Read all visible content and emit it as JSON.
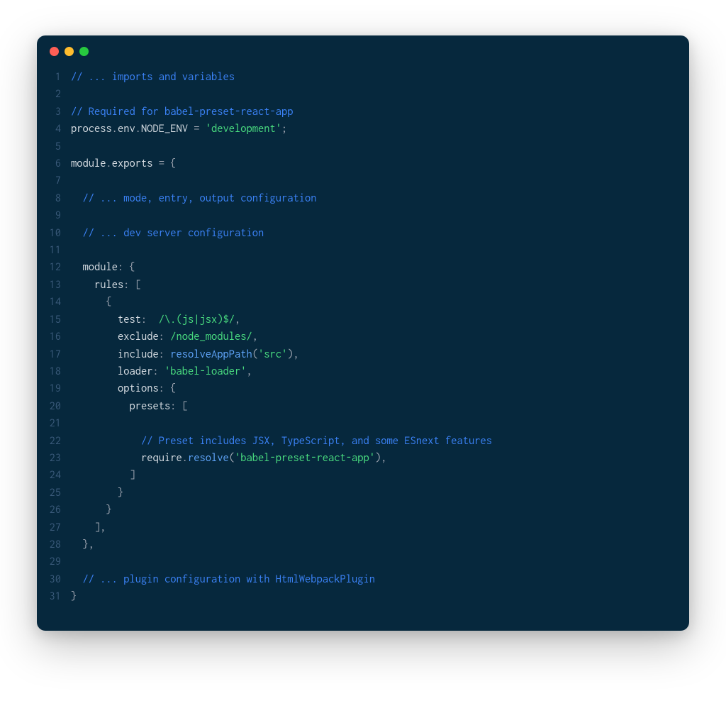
{
  "window": {
    "traffic_lights": {
      "close": "close",
      "minimize": "minimize",
      "maximize": "maximize"
    }
  },
  "code": {
    "lines": [
      {
        "num": "1",
        "tokens": [
          {
            "c": "tok-comment",
            "t": "// ... imports and variables"
          }
        ]
      },
      {
        "num": "2",
        "tokens": []
      },
      {
        "num": "3",
        "tokens": [
          {
            "c": "tok-comment",
            "t": "// Required for babel-preset-react-app"
          }
        ]
      },
      {
        "num": "4",
        "tokens": [
          {
            "c": "tok-ident",
            "t": "process"
          },
          {
            "c": "tok-punct",
            "t": "."
          },
          {
            "c": "tok-ident",
            "t": "env"
          },
          {
            "c": "tok-punct",
            "t": "."
          },
          {
            "c": "tok-ident",
            "t": "NODE_ENV"
          },
          {
            "c": "tok-op",
            "t": " = "
          },
          {
            "c": "tok-string",
            "t": "'development'"
          },
          {
            "c": "tok-punct",
            "t": ";"
          }
        ]
      },
      {
        "num": "5",
        "tokens": []
      },
      {
        "num": "6",
        "tokens": [
          {
            "c": "tok-ident",
            "t": "module"
          },
          {
            "c": "tok-punct",
            "t": "."
          },
          {
            "c": "tok-ident",
            "t": "exports"
          },
          {
            "c": "tok-op",
            "t": " = "
          },
          {
            "c": "tok-punct",
            "t": "{"
          }
        ]
      },
      {
        "num": "7",
        "tokens": []
      },
      {
        "num": "8",
        "tokens": [
          {
            "c": "",
            "t": "  "
          },
          {
            "c": "tok-comment",
            "t": "// ... mode, entry, output configuration"
          }
        ]
      },
      {
        "num": "9",
        "tokens": []
      },
      {
        "num": "10",
        "tokens": [
          {
            "c": "",
            "t": "  "
          },
          {
            "c": "tok-comment",
            "t": "// ... dev server configuration"
          }
        ]
      },
      {
        "num": "11",
        "tokens": []
      },
      {
        "num": "12",
        "tokens": [
          {
            "c": "",
            "t": "  "
          },
          {
            "c": "tok-prop",
            "t": "module"
          },
          {
            "c": "tok-punct",
            "t": ": {"
          }
        ]
      },
      {
        "num": "13",
        "tokens": [
          {
            "c": "",
            "t": "    "
          },
          {
            "c": "tok-prop",
            "t": "rules"
          },
          {
            "c": "tok-punct",
            "t": ": ["
          }
        ]
      },
      {
        "num": "14",
        "tokens": [
          {
            "c": "",
            "t": "      "
          },
          {
            "c": "tok-punct",
            "t": "{"
          }
        ]
      },
      {
        "num": "15",
        "tokens": [
          {
            "c": "",
            "t": "        "
          },
          {
            "c": "tok-prop",
            "t": "test"
          },
          {
            "c": "tok-punct",
            "t": ":  "
          },
          {
            "c": "tok-regex",
            "t": "/\\.(js|jsx)$/"
          },
          {
            "c": "tok-punct",
            "t": ","
          }
        ]
      },
      {
        "num": "16",
        "tokens": [
          {
            "c": "",
            "t": "        "
          },
          {
            "c": "tok-prop",
            "t": "exclude"
          },
          {
            "c": "tok-punct",
            "t": ": "
          },
          {
            "c": "tok-regex",
            "t": "/node_modules/"
          },
          {
            "c": "tok-punct",
            "t": ","
          }
        ]
      },
      {
        "num": "17",
        "tokens": [
          {
            "c": "",
            "t": "        "
          },
          {
            "c": "tok-prop",
            "t": "include"
          },
          {
            "c": "tok-punct",
            "t": ": "
          },
          {
            "c": "tok-func",
            "t": "resolveAppPath"
          },
          {
            "c": "tok-punct",
            "t": "("
          },
          {
            "c": "tok-string",
            "t": "'src'"
          },
          {
            "c": "tok-punct",
            "t": "),"
          }
        ]
      },
      {
        "num": "18",
        "tokens": [
          {
            "c": "",
            "t": "        "
          },
          {
            "c": "tok-prop",
            "t": "loader"
          },
          {
            "c": "tok-punct",
            "t": ": "
          },
          {
            "c": "tok-string",
            "t": "'babel-loader'"
          },
          {
            "c": "tok-punct",
            "t": ","
          }
        ]
      },
      {
        "num": "19",
        "tokens": [
          {
            "c": "",
            "t": "        "
          },
          {
            "c": "tok-prop",
            "t": "options"
          },
          {
            "c": "tok-punct",
            "t": ": {"
          }
        ]
      },
      {
        "num": "20",
        "tokens": [
          {
            "c": "",
            "t": "          "
          },
          {
            "c": "tok-prop",
            "t": "presets"
          },
          {
            "c": "tok-punct",
            "t": ": ["
          }
        ]
      },
      {
        "num": "21",
        "tokens": []
      },
      {
        "num": "22",
        "tokens": [
          {
            "c": "",
            "t": "            "
          },
          {
            "c": "tok-comment",
            "t": "// Preset includes JSX, TypeScript, and some ESnext features"
          }
        ]
      },
      {
        "num": "23",
        "tokens": [
          {
            "c": "",
            "t": "            "
          },
          {
            "c": "tok-ident",
            "t": "require"
          },
          {
            "c": "tok-punct",
            "t": "."
          },
          {
            "c": "tok-func",
            "t": "resolve"
          },
          {
            "c": "tok-punct",
            "t": "("
          },
          {
            "c": "tok-string",
            "t": "'babel-preset-react-app'"
          },
          {
            "c": "tok-punct",
            "t": "),"
          }
        ]
      },
      {
        "num": "24",
        "tokens": [
          {
            "c": "",
            "t": "          "
          },
          {
            "c": "tok-punct",
            "t": "]"
          }
        ]
      },
      {
        "num": "25",
        "tokens": [
          {
            "c": "",
            "t": "        "
          },
          {
            "c": "tok-punct",
            "t": "}"
          }
        ]
      },
      {
        "num": "26",
        "tokens": [
          {
            "c": "",
            "t": "      "
          },
          {
            "c": "tok-punct",
            "t": "}"
          }
        ]
      },
      {
        "num": "27",
        "tokens": [
          {
            "c": "",
            "t": "    "
          },
          {
            "c": "tok-punct",
            "t": "],"
          }
        ]
      },
      {
        "num": "28",
        "tokens": [
          {
            "c": "",
            "t": "  "
          },
          {
            "c": "tok-punct",
            "t": "},"
          }
        ]
      },
      {
        "num": "29",
        "tokens": []
      },
      {
        "num": "30",
        "tokens": [
          {
            "c": "",
            "t": "  "
          },
          {
            "c": "tok-comment",
            "t": "// ... plugin configuration with HtmlWebpackPlugin"
          }
        ]
      },
      {
        "num": "31",
        "tokens": [
          {
            "c": "tok-punct",
            "t": "}"
          }
        ]
      }
    ]
  }
}
